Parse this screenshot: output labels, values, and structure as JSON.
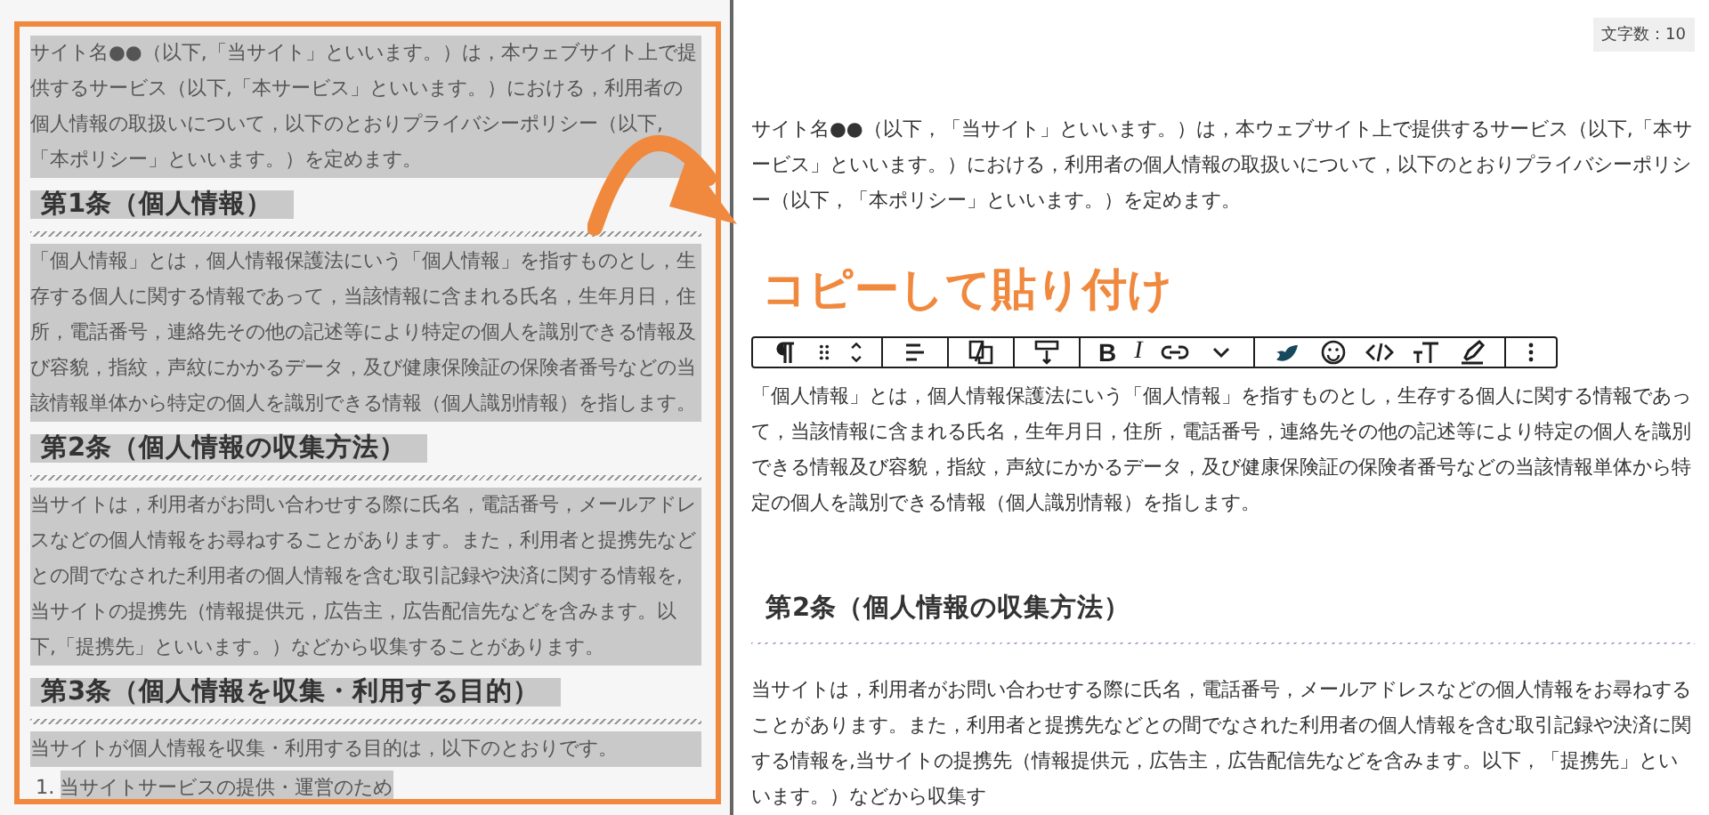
{
  "source_panel": {
    "blocks": [
      {
        "kind": "paragraph",
        "selected": true,
        "text": "サイト名●●（以下,「当サイト」といいます。）は，本ウェブサイト上で提供するサービス（以下,「本サービス」といいます。）における，利用者の個人情報の取扱いについて，以下のとおりプライバシーポリシー（以下,「本ポリシー」といいます。）を定めます。"
      },
      {
        "kind": "heading",
        "selected": true,
        "text": "第1条（個人情報）"
      },
      {
        "kind": "paragraph",
        "selected": true,
        "text": "「個人情報」とは，個人情報保護法にいう「個人情報」を指すものとし，生存する個人に関する情報であって，当該情報に含まれる氏名，生年月日，住所，電話番号，連絡先その他の記述等により特定の個人を識別できる情報及び容貌，指紋，声紋にかかるデータ，及び健康保険証の保険者番号などの当該情報単体から特定の個人を識別できる情報（個人識別情報）を指します。"
      },
      {
        "kind": "heading",
        "selected": true,
        "text": "第2条（個人情報の収集方法）"
      },
      {
        "kind": "paragraph",
        "selected": true,
        "text": "当サイトは，利用者がお問い合わせする際に氏名，電話番号，メールアドレスなどの個人情報をお尋ねすることがあります。また，利用者と提携先などとの間でなされた利用者の個人情報を含む取引記録や決済に関する情報を,当サイトの提携先（情報提供元，広告主，広告配信先などを含みます。以下,「提携先」といいます。）などから収集することがあります。"
      },
      {
        "kind": "heading",
        "selected": true,
        "text": "第3条（個人情報を収集・利用する目的）"
      },
      {
        "kind": "paragraph",
        "selected": true,
        "text": "当サイトが個人情報を収集・利用する目的は，以下のとおりです。"
      },
      {
        "kind": "list_item",
        "selected": true,
        "number": "1.",
        "text": "当サイトサービスの提供・運営のため"
      }
    ]
  },
  "editor": {
    "word_count": "文字数：10",
    "toolbar": {
      "bold": "B",
      "italic": "I"
    },
    "blocks": [
      {
        "kind": "paragraph",
        "selected": false,
        "text": "サイト名●●（以下，「当サイト」といいます。）は，本ウェブサイト上で提供するサービス（以下,「本サービス」といいます。）における，利用者の個人情報の取扱いについて，以下のとおりプライバシーポリシー（以下，「本ポリシー」といいます。）を定めます。"
      },
      {
        "kind": "toolbar"
      },
      {
        "kind": "paragraph",
        "selected": false,
        "text": "「個人情報」とは，個人情報保護法にいう「個人情報」を指すものとし，生存する個人に関する情報であって，当該情報に含まれる氏名，生年月日，住所，電話番号，連絡先その他の記述等により特定の個人を識別できる情報及び容貌，指紋，声紋にかかるデータ，及び健康保険証の保険者番号などの当該情報単体から特定の個人を識別できる情報（個人識別情報）を指します。"
      },
      {
        "kind": "heading",
        "selected": false,
        "text": "第2条（個人情報の収集方法）"
      },
      {
        "kind": "paragraph",
        "selected": false,
        "text": "当サイトは，利用者がお問い合わせする際に氏名，電話番号，メールアドレスなどの個人情報をお尋ねすることがあります。また，利用者と提携先などとの間でなされた利用者の個人情報を含む取引記録や決済に関する情報を,当サイトの提携先（情報提供元，広告主，広告配信先などを含みます。以下，「提携先」といいます。）などから収集す"
      }
    ]
  },
  "annotation": {
    "label": "コピーして貼り付け"
  }
}
